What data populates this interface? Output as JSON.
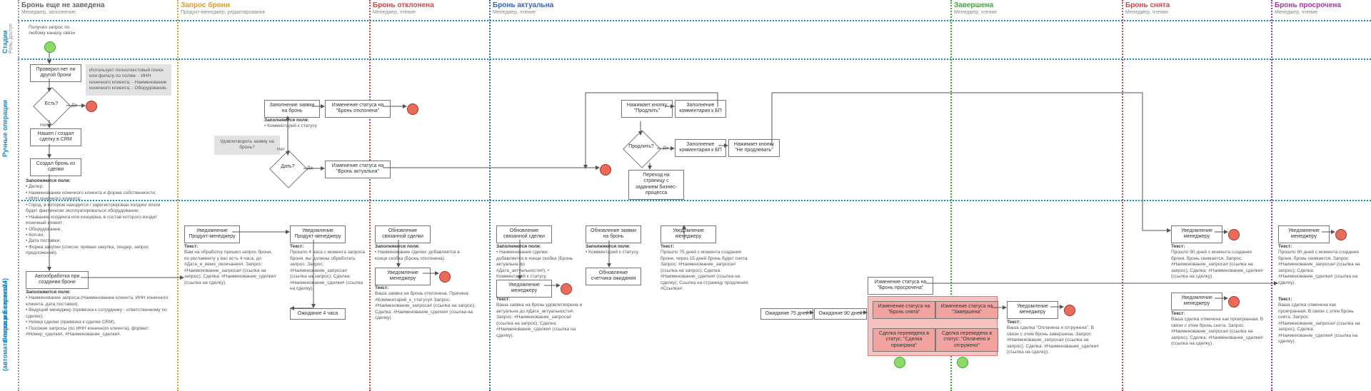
{
  "lanes": {
    "stages": "Стадии",
    "stages_sub": "Роль, доступ",
    "manual": "Ручные операции",
    "auto1": "Операции системы",
    "auto2": "(автоматически в Битрикс24)"
  },
  "stages": {
    "s1": {
      "title": "Бронь еще не заведена",
      "sub": "Менеджер, заполнение"
    },
    "s2": {
      "title": "Запрос брони",
      "sub": "Продукт-менеджер, редактирование"
    },
    "s3": {
      "title": "Бронь отклонена",
      "sub": "Менеджер, чтение"
    },
    "s4": {
      "title": "Бронь актуальна",
      "sub": "Менеджер, чтение"
    },
    "s5": {
      "title": "Завершена",
      "sub": "Менеджер, чтение"
    },
    "s6": {
      "title": "Бронь снята",
      "sub": "Менеджер, чтение"
    },
    "s7": {
      "title": "Бронь просрочена",
      "sub": "Менеджер, чтение"
    }
  },
  "start": "Получил запрос по любому каналу связи",
  "m": {
    "check": "Проверил нет ли другой брони",
    "exists": "Есть?",
    "yes": "Да",
    "no": "Нет",
    "found": "Нашел / создал сделку в CRM",
    "create": "Создал бронь из сделки",
    "note1": "Использует полнотекстовый поиск или фильтр по полям:\n- ИНН конечного клиента;\n- Наименование конечного клиента;\n- Оборудование.",
    "fill": "Заполнение заявки на бронь",
    "fill_lbl": "Заполняются поля:",
    "fill_item": "• Комментарий к статусу",
    "q_approve": "Удовлетворить заявку на бронь?",
    "give": "Дать?",
    "st_decl": "Изменение статуса на \"Бронь отклонена\"",
    "st_act": "Изменение статуса на \"Бронь актуальна\"",
    "press_ext": "Нажимает кнопку \"Продлить\"",
    "fill_cmt": "Заполнение комментария к БП",
    "extend": "Продлить?",
    "press_no": "Нажимает кнопку \"Не продлевать\"",
    "goto_bp": "Переход на страницу с заданием бизнес-процесса"
  },
  "f1": {
    "title": "Заполняются поля:",
    "i1": "• Дилер;",
    "i2": "• Наименование конечного клиента и форма собственности;",
    "i3": "• ИНН конечного клиента;",
    "i4": "• Город, в котором находится / зарегистрирован холдинг и/или будет фактически эксплуатироваться оборудование;",
    "i5": "• Название холдинга или концерна, в состав которого входит конечный клиент;",
    "i6": "• Оборудование;",
    "i7": "• Кол-во;",
    "i8": "• Дата поставки;",
    "i9": "• Форма закупки (список: прямая закупка, тендер, запрос предложений)."
  },
  "f2": {
    "title": "Автообработка при создании брони",
    "t2": "Заполняются поля:",
    "i1": "• Наименование запроса (Наименование клиента, ИНН конечного клиента, дата поставки);",
    "i2": "• Ведущий менеджер (привязка к сотруднику - ответственному по сделке);",
    "i3": "• Номер сделки (привязка к сделке CRM);",
    "i4": "• Похожие запросы (по ИНН конечного клиента), формат: #Номер_сделки#, #Наименование_сделки#."
  },
  "a": {
    "notify_pm": "Уведомление Продукт-менеджеру",
    "notify_m": "Уведомление менеджеру",
    "upd_deal": "Обновление связанной сделки",
    "upd_req": "Обновление заявки на бронь",
    "upd_wait": "Обновление счетчика ожидания",
    "wait4h": "Ожидание 4 часа",
    "wait75": "Ожидание 75 дней",
    "wait90": "Ожидание 90 дней",
    "st_snyata": "Изменение статуса на \"Бронь снята\"",
    "st_done": "Изменение статуса на \"Завершена\"",
    "st_over": "Изменение статуса на \"Бронь просрочена\"",
    "deal_over": "Сделка переведена в статус: \"Сделка проиграна\"",
    "deal_ship": "Сделка переведена в статус: \"Оплачено и отгружено\""
  },
  "t": {
    "t1_h": "Текст:",
    "t1": "Вам на обработку пришел запрос брони, по регламенту у вас есть 4 часа, до #Дата_и_вемя_окончания#.\nЗапрос: #Наименование_запроса# (ссылка на запрос);\nСделка: #Наименование_сделки# (ссылка на сделку).",
    "t2": "Прошло 4 часа с момента запроса брони, вы должны обработать запрос.\nЗапрос: #Наименование_запроса# (ссылка на запрос);\nСделка: #Наименование_сделки# (ссылка на сделку).",
    "t3_h": "Заполняются поля:",
    "t3": "• Наименование сделки: добавляется в конце скобка (Бронь отклонена).",
    "t4": "Ваша заявка на бронь отклонена.\nПричина: #Комментарий_к_статусу#\nЗапрос: #Наименование_запроса# (ссылка на запрос);\nСделка: #Наименование_сделки# (ссылка на сделку).",
    "t5": "• Наименование сделки: добавляется в конце скобка (Бронь актуальна до #Дата_актуальности#);\n• Комментарий к статусу.",
    "t6": "Ваша заявка на бронь удовлетворена и актуальна до #Дата_актуальности#.\nЗапрос: #Наименование_запроса# (ссылка на запрос);\nСделка: #Наименование_сделки# (ссылка на сделку).",
    "t5b_h": "Заполняются поля:",
    "t5b": "• Комментарий к статусу.",
    "t7": "Прошло 75 дней с момента создания брони, через 15 дней бронь будет снята.\nЗапрос: #Наименование_запроса# (ссылка на запрос);\nСделка: #Наименование_сделки# (ссылка на сделку);\nСсылка на страницу продления: #Ссылка#.",
    "t8": "Ваша сделка \"Оплачена и отгружена\".\nВ связи с этим бронь завершена.\nЗапрос: #Наименование_запроса# (ссылка на запрос);\nСделка: #Наименование_сделки# (ссылка на сделку).",
    "t9": "Прошло 90 дней с момента создания брони, бронь снимается.\nЗапрос: #Наименование_запроса# (ссылка на запрос);\nСделка: #Наименование_сделки# (ссылка на сделку).",
    "t10": "Ваша сделка отмечена как проигранная.\nВ связи с этим бронь снята.\nЗапрос: #Наименование_запроса# (ссылка на запрос);\nСделка: #Наименование_сделки# (ссылка на сделку)."
  }
}
